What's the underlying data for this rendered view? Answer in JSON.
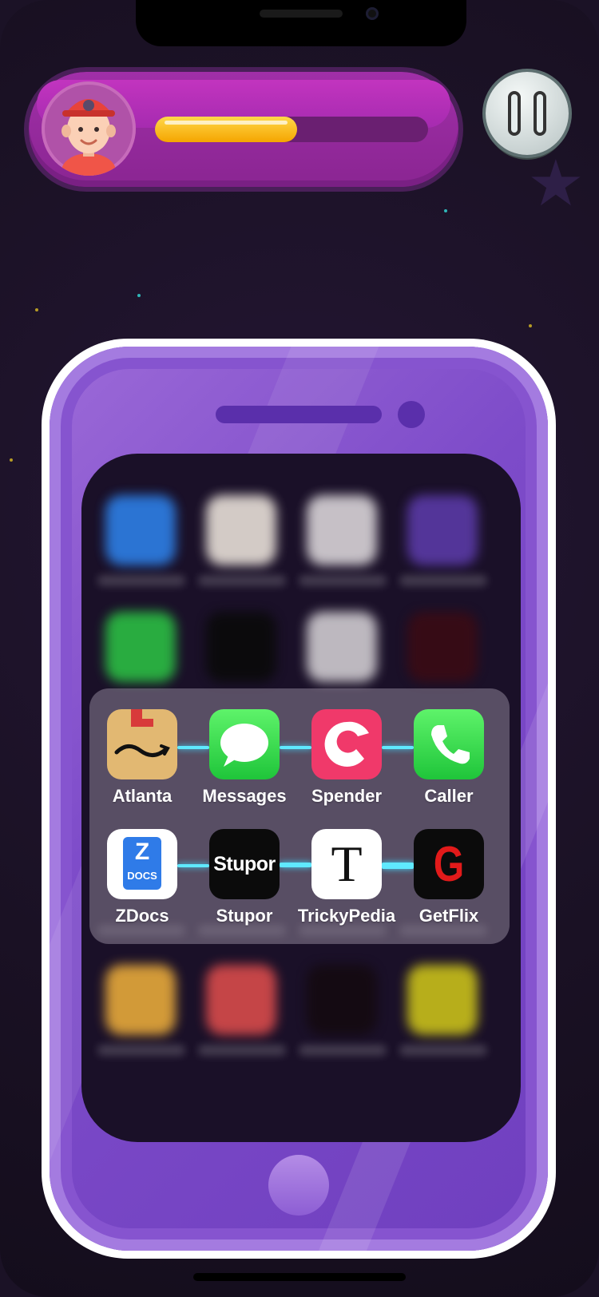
{
  "hud": {
    "progress": 0.52,
    "avatar": "boy-red-cap-avatar",
    "pause_icon": "pause-icon"
  },
  "folder": {
    "apps": [
      {
        "label": "Atlanta",
        "icon": "shopping-box-icon"
      },
      {
        "label": "Messages",
        "icon": "speech-bubble-icon"
      },
      {
        "label": "Spender",
        "icon": "bird-logo-icon"
      },
      {
        "label": "Caller",
        "icon": "phone-icon"
      },
      {
        "label": "ZDocs",
        "icon": "document-icon",
        "tile_text_1": "Z",
        "tile_text_2": "DOCS"
      },
      {
        "label": "Stupor",
        "icon": "stupor-wordmark-icon",
        "tile_text": "Stupor"
      },
      {
        "label": "TrickyPedia",
        "icon": "letter-t-icon",
        "tile_text": "T"
      },
      {
        "label": "GetFlix",
        "icon": "letter-g-icon",
        "tile_text": "G"
      }
    ]
  },
  "colors": {
    "link": "#5fe9ff",
    "hud_bar": "#a12fa8",
    "progress": "#f5a500",
    "phone": "#7d4bc9"
  }
}
